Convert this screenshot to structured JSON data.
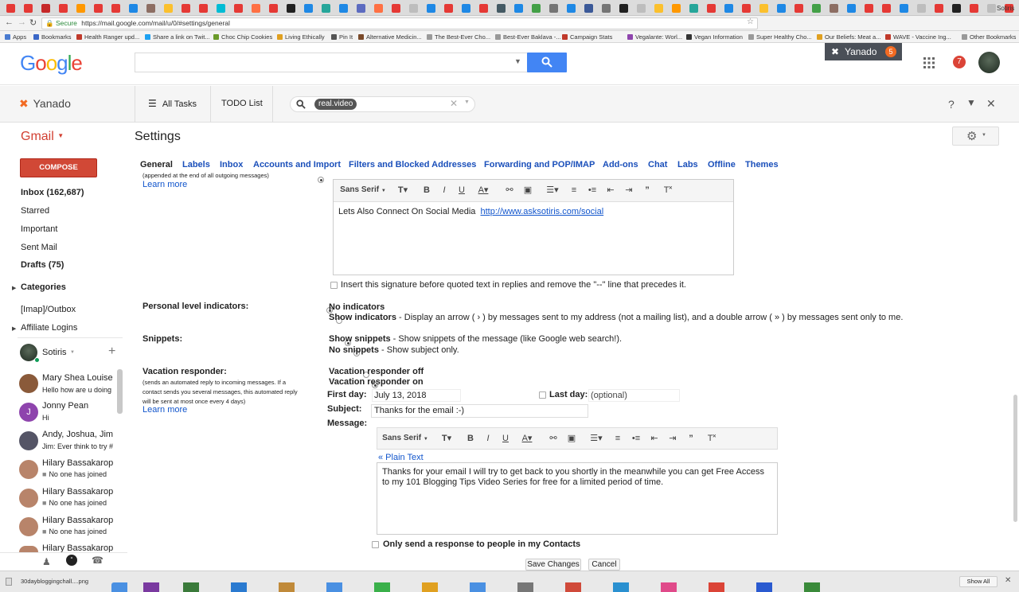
{
  "browser": {
    "user": "Sotiris",
    "secure_label": "Secure",
    "url": "https://mail.google.com/mail/u/0/#settings/general",
    "bookmarks": [
      "Apps",
      "Bookmarks",
      "Health Ranger upd...",
      "Share a link on Twit...",
      "Choc Chip Cookies",
      "Living Ethically",
      "Pin It",
      "Alternative Medicin...",
      "The Best-Ever Cho...",
      "Best-Ever Baklava -...",
      "Campaign Stats",
      "Vegalante: Worl...",
      "Vegan Information",
      "Super Healthy Cho...",
      "Our Beliefs: Meat a...",
      "WAVE - Vaccine Ing...",
      "Other Bookmarks"
    ]
  },
  "google": {
    "logo": "Google",
    "yanado_label": "Yanado",
    "yanado_count": "5",
    "notif_count": "7"
  },
  "yanado": {
    "logo": "Yanado",
    "all_tasks": "All Tasks",
    "todo": "TODO List",
    "search_chip": "real.video",
    "help": "?"
  },
  "gmail": {
    "logo": "Gmail",
    "page_title": "Settings",
    "compose": "COMPOSE",
    "nav": {
      "inbox": "Inbox (162,687)",
      "starred": "Starred",
      "important": "Important",
      "sent": "Sent Mail",
      "drafts": "Drafts (75)",
      "categories": "Categories",
      "outbox": "[Imap]/Outbox",
      "affiliate": "Affiliate Logins"
    },
    "chat_user": "Sotiris",
    "chats": [
      {
        "name": "Mary Shea Louise",
        "sub": "Hello how are u doing",
        "avatar": "#8a5a3a"
      },
      {
        "name": "Jonny Pean",
        "sub": "Hi",
        "avatar": "#8e44ad",
        "initial": "J"
      },
      {
        "name": "Andy, Joshua, Jim",
        "sub": "Jim: Ever think to try #",
        "avatar": "#556"
      },
      {
        "name": "Hilary Bassakarop",
        "sub": "No one has joined",
        "avatar": "#b8846a"
      },
      {
        "name": "Hilary Bassakarop",
        "sub": "No one has joined",
        "avatar": "#b8846a"
      },
      {
        "name": "Hilary Bassakarop",
        "sub": "No one has joined",
        "avatar": "#b8846a"
      },
      {
        "name": "Hilary Bassakarop",
        "sub": "",
        "avatar": "#b8846a"
      }
    ]
  },
  "settings": {
    "tabs": [
      "General",
      "Labels",
      "Inbox",
      "Accounts and Import",
      "Filters and Blocked Addresses",
      "Forwarding and POP/IMAP",
      "Add-ons",
      "Chat",
      "Labs",
      "Offline",
      "Themes"
    ],
    "sig_note": "(appended at the end of all outgoing messages)",
    "learn_more": "Learn more",
    "toolbar_font": "Sans Serif",
    "signature_text": "Lets Also Connect On Social Media",
    "signature_link": "http://www.asksotiris.com/social",
    "sig_checkbox": "Insert this signature before quoted text in replies and remove the \"--\" line that precedes it.",
    "pli_label": "Personal level indicators:",
    "pli_opt1": "No indicators",
    "pli_opt2_b": "Show indicators",
    "pli_opt2_rest": " - Display an arrow ( › ) by messages sent to my address (not a mailing list), and a double arrow ( » ) by messages sent only to me.",
    "snip_label": "Snippets:",
    "snip_opt1_b": "Show snippets",
    "snip_opt1_rest": " - Show snippets of the message (like Google web search!).",
    "snip_opt2_b": "No snippets",
    "snip_opt2_rest": " - Show subject only.",
    "vac_label": "Vacation responder:",
    "vac_note": "(sends an automated reply to incoming messages. If a contact sends you several messages, this automated reply will be sent at most once every 4 days)",
    "vac_off": "Vacation responder off",
    "vac_on": "Vacation responder on",
    "first_day_label": "First day:",
    "first_day": "July 13, 2018",
    "last_day_label": "Last day:",
    "last_day_placeholder": "(optional)",
    "subject_label": "Subject:",
    "subject": "Thanks for the email :-)",
    "message_label": "Message:",
    "plain_text": "« Plain Text",
    "message": "Thanks for your email I will try to get back to you shortly in the meanwhile you can get Free Access to my 101 Blogging Tips Video Series for free for a limited period of time.",
    "contacts_only": "Only send a response to people in my Contacts",
    "save": "Save Changes",
    "cancel": "Cancel"
  },
  "taskbar": {
    "download": "30daybloggingchall....png",
    "show_all": "Show All"
  }
}
